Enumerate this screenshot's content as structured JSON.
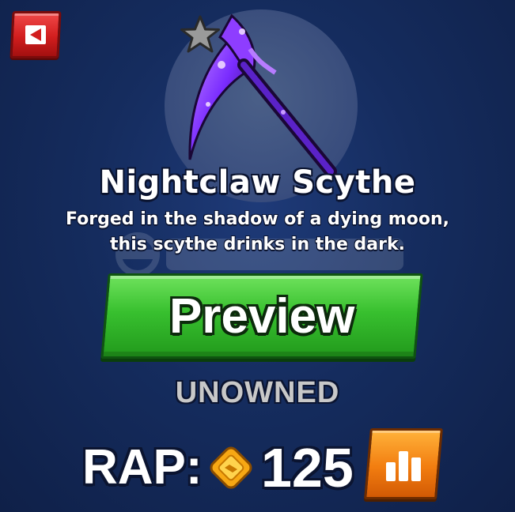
{
  "item": {
    "name": "Nightclaw Scythe",
    "description": "Forged in the shadow of a dying moon, this scythe drinks in the dark.",
    "status": "UNOWNED",
    "rarity_icon": "star-icon"
  },
  "actions": {
    "back_icon": "back-arrow-icon",
    "preview_label": "Preview",
    "value_history_icon": "bar-chart-icon"
  },
  "rap": {
    "label": "RAP:",
    "value": "125",
    "currency_icon": "coin-icon"
  },
  "colors": {
    "background": "#152c5e",
    "back_button": "#d21e1e",
    "preview_button": "#38c02f",
    "chart_button": "#f27d10",
    "status_text": "#c8c8c8",
    "item_glow": "#9b4dff"
  }
}
